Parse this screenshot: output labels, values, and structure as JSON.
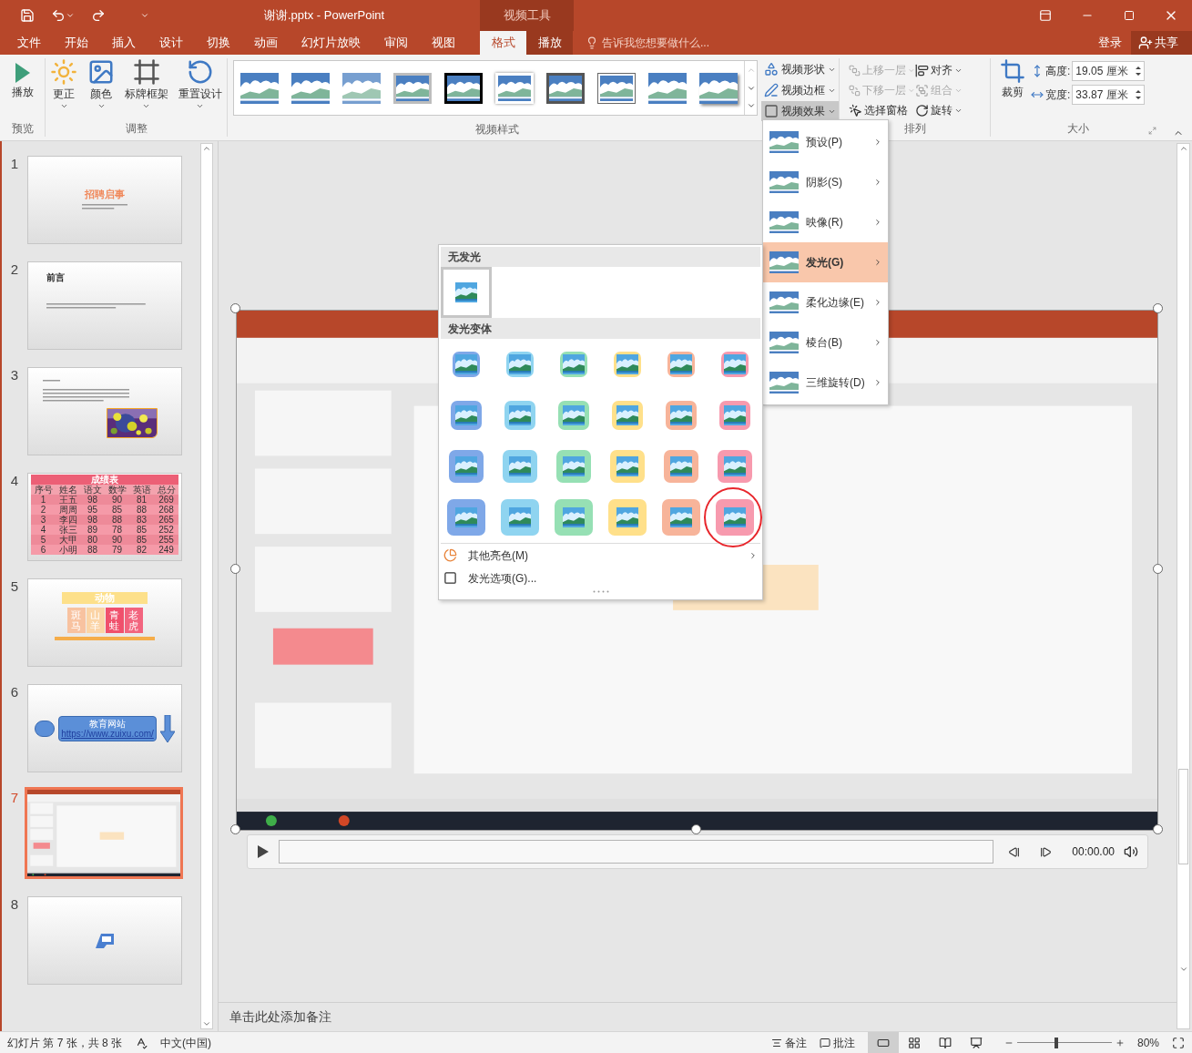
{
  "window": {
    "title": "谢谢.pptx - PowerPoint",
    "context_group": "视频工具"
  },
  "ribbon_tabs": [
    {
      "label": "文件",
      "selected": false,
      "contextual": false
    },
    {
      "label": "开始",
      "selected": false,
      "contextual": false
    },
    {
      "label": "插入",
      "selected": false,
      "contextual": false
    },
    {
      "label": "设计",
      "selected": false,
      "contextual": false
    },
    {
      "label": "切换",
      "selected": false,
      "contextual": false
    },
    {
      "label": "动画",
      "selected": false,
      "contextual": false
    },
    {
      "label": "幻灯片放映",
      "selected": false,
      "contextual": false
    },
    {
      "label": "审阅",
      "selected": false,
      "contextual": false
    },
    {
      "label": "视图",
      "selected": false,
      "contextual": false
    },
    {
      "label": "格式",
      "selected": true,
      "contextual": true
    },
    {
      "label": "播放",
      "selected": false,
      "contextual": true
    }
  ],
  "tell_me": {
    "placeholder": "告诉我您想要做什么..."
  },
  "account": {
    "sign_in": "登录",
    "share": "共享"
  },
  "ribbon": {
    "preview_group": {
      "label": "预览",
      "play": "播放"
    },
    "adjust_group": {
      "label": "调整",
      "buttons": [
        {
          "label": "更正",
          "dropdown": true
        },
        {
          "label": "颜色",
          "dropdown": true
        },
        {
          "label": "标牌框架",
          "dropdown": true
        },
        {
          "label": "重置设计",
          "dropdown": true
        }
      ]
    },
    "styles_group": {
      "label": "视频样式",
      "styles": [
        {
          "kind": "plain"
        },
        {
          "kind": "plain"
        },
        {
          "kind": "soft"
        },
        {
          "kind": "gray-frame"
        },
        {
          "kind": "black-frame"
        },
        {
          "kind": "white-frame"
        },
        {
          "kind": "dark-frame"
        },
        {
          "kind": "thin-frame"
        },
        {
          "kind": "plain"
        },
        {
          "kind": "shadow"
        }
      ],
      "commands": [
        {
          "label": "视频形状",
          "pressed": false
        },
        {
          "label": "视频边框",
          "pressed": false
        },
        {
          "label": "视频效果",
          "pressed": true
        }
      ]
    },
    "arrange_group": {
      "label": "排列",
      "commands": [
        {
          "label": "上移一层",
          "disabled": true,
          "dropdown": true
        },
        {
          "label": "下移一层",
          "disabled": true,
          "dropdown": true
        },
        {
          "label": "选择窗格",
          "disabled": false,
          "dropdown": false
        },
        {
          "label": "对齐",
          "disabled": false,
          "dropdown": true
        },
        {
          "label": "组合",
          "disabled": true,
          "dropdown": true
        },
        {
          "label": "旋转",
          "disabled": false,
          "dropdown": true
        }
      ]
    },
    "size_group": {
      "label": "大小",
      "crop": "裁剪",
      "height": {
        "label": "高度:",
        "value": "19.05 厘米"
      },
      "width": {
        "label": "宽度:",
        "value": "33.87 厘米"
      }
    }
  },
  "effects_menu": [
    {
      "label": "预设(P)",
      "selected": false
    },
    {
      "label": "阴影(S)",
      "selected": false
    },
    {
      "label": "映像(R)",
      "selected": false
    },
    {
      "label": "发光(G)",
      "selected": true
    },
    {
      "label": "柔化边缘(E)",
      "selected": false
    },
    {
      "label": "棱台(B)",
      "selected": false
    },
    {
      "label": "三维旋转(D)",
      "selected": false
    }
  ],
  "glow_gallery": {
    "no_glow_header": "无发光",
    "no_glow": {
      "selected": true
    },
    "variants_header": "发光变体",
    "rows": [
      [
        {
          "color": "#7fa8e8",
          "selected": false,
          "circled": false
        },
        {
          "color": "#8fd4f0",
          "selected": false,
          "circled": false
        },
        {
          "color": "#96e0b4",
          "selected": false,
          "circled": false
        },
        {
          "color": "#ffe08a",
          "selected": false,
          "circled": false
        },
        {
          "color": "#f7b49a",
          "selected": false,
          "circled": false
        },
        {
          "color": "#f79aae",
          "selected": false,
          "circled": false
        }
      ],
      [
        {
          "color": "#7fa8e8",
          "selected": false,
          "circled": false
        },
        {
          "color": "#8fd4f0",
          "selected": false,
          "circled": false
        },
        {
          "color": "#96e0b4",
          "selected": false,
          "circled": false
        },
        {
          "color": "#ffe08a",
          "selected": false,
          "circled": false
        },
        {
          "color": "#f7b49a",
          "selected": false,
          "circled": false
        },
        {
          "color": "#f79aae",
          "selected": false,
          "circled": false
        }
      ],
      [
        {
          "color": "#7fa8e8",
          "selected": false,
          "circled": false
        },
        {
          "color": "#8fd4f0",
          "selected": false,
          "circled": false
        },
        {
          "color": "#96e0b4",
          "selected": false,
          "circled": false
        },
        {
          "color": "#ffe08a",
          "selected": false,
          "circled": false
        },
        {
          "color": "#f7b49a",
          "selected": false,
          "circled": false
        },
        {
          "color": "#f79aae",
          "selected": false,
          "circled": false
        }
      ],
      [
        {
          "color": "#7fa8e8",
          "selected": false,
          "circled": false
        },
        {
          "color": "#8fd4f0",
          "selected": false,
          "circled": false
        },
        {
          "color": "#96e0b4",
          "selected": false,
          "circled": false
        },
        {
          "color": "#ffe08a",
          "selected": false,
          "circled": false
        },
        {
          "color": "#f7b49a",
          "selected": false,
          "circled": false
        },
        {
          "color": "#f79aae",
          "selected": false,
          "circled": true
        }
      ]
    ],
    "more_colors": "其他亮色(M)",
    "options": "发光选项(G)..."
  },
  "slides": [
    {
      "number": "1",
      "selected": false,
      "kind": "title",
      "title": "招聘启事"
    },
    {
      "number": "2",
      "selected": false,
      "kind": "heading",
      "title": "前言"
    },
    {
      "number": "3",
      "selected": false,
      "kind": "text-photo"
    },
    {
      "number": "4",
      "selected": false,
      "kind": "table",
      "title": "成绩表",
      "columns": [
        "序号",
        "姓名",
        "语文",
        "数学",
        "英语",
        "总分"
      ],
      "rows": [
        [
          "1",
          "王五",
          "98",
          "90",
          "81",
          "269"
        ],
        [
          "2",
          "周周",
          "95",
          "85",
          "88",
          "268"
        ],
        [
          "3",
          "李四",
          "98",
          "88",
          "83",
          "265"
        ],
        [
          "4",
          "张三",
          "89",
          "78",
          "85",
          "252"
        ],
        [
          "5",
          "大甲",
          "80",
          "90",
          "85",
          "255"
        ],
        [
          "6",
          "小明",
          "88",
          "79",
          "82",
          "249"
        ]
      ]
    },
    {
      "number": "5",
      "selected": false,
      "kind": "tiles",
      "banner": "动物",
      "tiles": [
        {
          "text": "斑马",
          "color": "#f8c2a0"
        },
        {
          "text": "山羊",
          "color": "#fbd4a6"
        },
        {
          "text": "青蛙",
          "color": "#f0506c"
        },
        {
          "text": "老虎",
          "color": "#f2647e"
        }
      ]
    },
    {
      "number": "6",
      "selected": false,
      "kind": "shapes",
      "box_title": "教育网站",
      "link": "https://www.zuixu.com/"
    },
    {
      "number": "7",
      "selected": true,
      "kind": "video"
    },
    {
      "number": "8",
      "selected": false,
      "kind": "shape"
    }
  ],
  "player": {
    "time": "00:00.00"
  },
  "notes": {
    "placeholder": "单击此处添加备注"
  },
  "status_bar": {
    "slide_info": "幻灯片 第 7 张，共 8 张",
    "language": "中文(中国)",
    "notes": "备注",
    "comments": "批注",
    "views": [
      {
        "selected": true
      },
      {
        "selected": false
      },
      {
        "selected": false
      },
      {
        "selected": false
      }
    ],
    "zoom_slider": {
      "level": 0.41
    },
    "zoom": "80%"
  }
}
